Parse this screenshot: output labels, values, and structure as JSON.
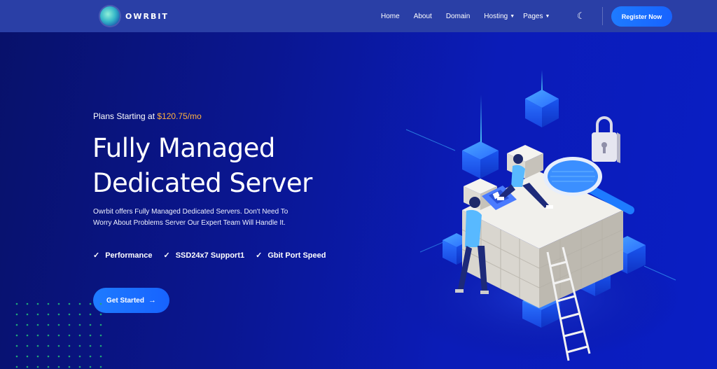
{
  "brand": {
    "name": "OWRBIT",
    "logo_icon": "globe-logo-icon"
  },
  "nav": {
    "items": [
      {
        "label": "Home",
        "has_dropdown": false
      },
      {
        "label": "About",
        "has_dropdown": false
      },
      {
        "label": "Domain",
        "has_dropdown": false
      },
      {
        "label": "Hosting",
        "has_dropdown": true
      },
      {
        "label": "Pages",
        "has_dropdown": true
      }
    ],
    "theme_icon": "moon-icon",
    "register_label": "Register Now"
  },
  "hero": {
    "plans_prefix": "Plans Starting at ",
    "plans_price": "$120.75/mo",
    "title_line1": "Fully Managed",
    "title_line2": "Dedicated Server",
    "description": "Owrbit offers Fully Managed Dedicated Servers. Don't Need To Worry About Problems Server Our Expert Team Will Handle It.",
    "features": [
      "Performance",
      "SSD24x7 Support1",
      "Gbit Port Speed"
    ],
    "cta_label": "Get Started"
  },
  "colors": {
    "background": "#0a1690",
    "navbar": "#2a3fa6",
    "accent": "#1e7bff",
    "price": "#ffb23e",
    "dots": "#1fa67a"
  }
}
